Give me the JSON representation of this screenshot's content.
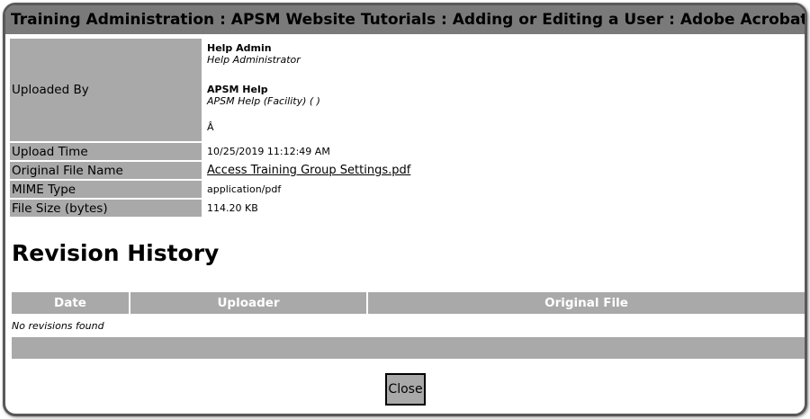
{
  "window": {
    "title": "Training Administration : APSM Website Tutorials : Adding or Editing a User : Adobe Acrobat File Info"
  },
  "file_info": {
    "uploaded_by_label": "Uploaded By",
    "uploaders": [
      {
        "name": "Help Admin",
        "role": "Help Administrator"
      },
      {
        "name": "APSM Help",
        "role": "APSM Help (Facility) ( )"
      }
    ],
    "uploaded_by_extra": "Â",
    "upload_time_label": "Upload Time",
    "upload_time": "10/25/2019 11:12:49 AM",
    "original_file_name_label": "Original File Name",
    "original_file_name": "Access Training Group Settings.pdf",
    "mime_type_label": "MIME Type",
    "mime_type": "application/pdf",
    "file_size_label": "File Size (bytes)",
    "file_size": "114.20 KB"
  },
  "revision_history": {
    "title": "Revision History",
    "columns": [
      "Date",
      "Uploader",
      "Original File"
    ],
    "empty_message": "No revisions found"
  },
  "buttons": {
    "close": "Close"
  },
  "colors": {
    "title_bar": "#7a7a7a",
    "label_bg": "#a9a9a9",
    "border": "#595959"
  }
}
